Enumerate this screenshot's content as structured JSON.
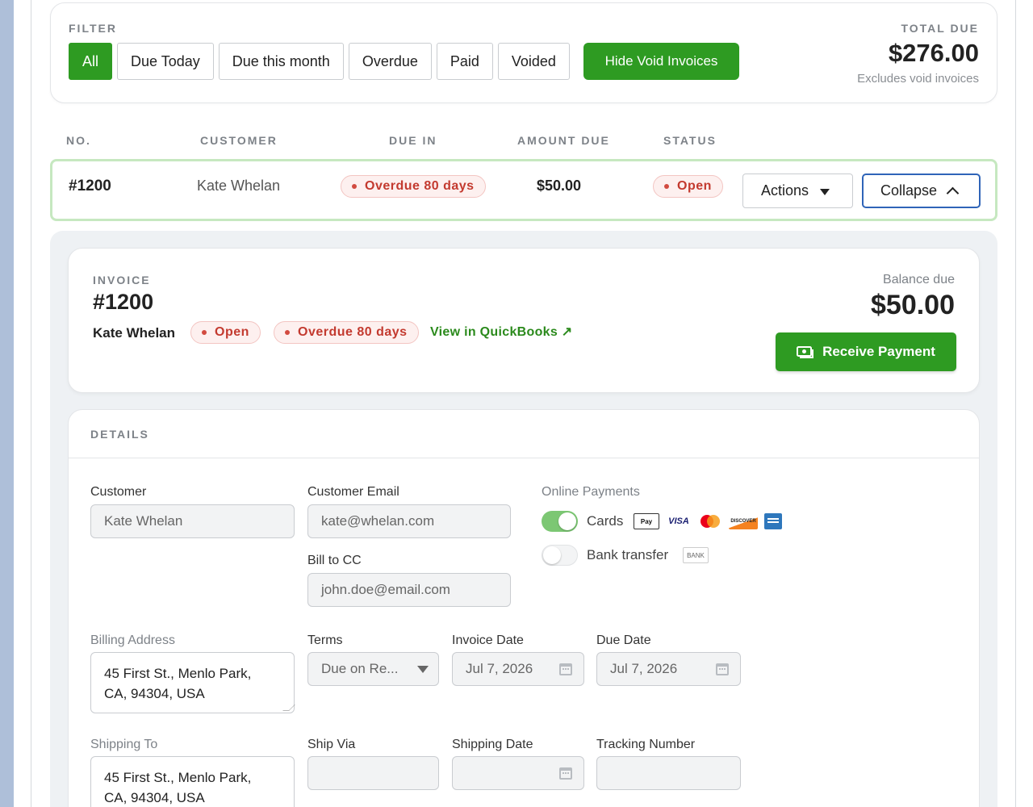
{
  "filter": {
    "label": "FILTER",
    "buttons": [
      "All",
      "Due Today",
      "Due this month",
      "Overdue",
      "Paid",
      "Voided"
    ],
    "active": "All",
    "hide_void": "Hide Void Invoices",
    "total_label": "TOTAL DUE",
    "total_value": "$276.00",
    "total_sub": "Excludes void invoices"
  },
  "table": {
    "headers": [
      "NO.",
      "CUSTOMER",
      "DUE IN",
      "AMOUNT DUE",
      "STATUS"
    ],
    "row": {
      "no": "#1200",
      "customer": "Kate Whelan",
      "due_in": "Overdue 80 days",
      "amount": "$50.00",
      "status": "Open",
      "actions": "Actions",
      "collapse": "Collapse"
    }
  },
  "invoice": {
    "label": "INVOICE",
    "number": "#1200",
    "customer": "Kate Whelan",
    "status": "Open",
    "overdue": "Overdue 80 days",
    "qb_link": "View in QuickBooks ↗",
    "balance_label": "Balance due",
    "balance_value": "$50.00",
    "receive_btn": "Receive Payment"
  },
  "details": {
    "title": "DETAILS",
    "customer_label": "Customer",
    "customer_value": "Kate Whelan",
    "email_label": "Customer Email",
    "email_value": "kate@whelan.com",
    "bcc_label": "Bill to CC",
    "bcc_value": "john.doe@email.com",
    "online_label": "Online Payments",
    "cards_label": "Cards",
    "cards_enabled": true,
    "bank_label": "Bank transfer",
    "bank_enabled": false,
    "bank_badge": "BANK",
    "card_logos": [
      "Pay",
      "VISA",
      "MasterCard",
      "DISCOVER",
      "AMEX"
    ],
    "billing_label": "Billing Address",
    "billing_line1": "45 First St., Menlo Park,",
    "billing_line2": "CA, 94304, USA",
    "terms_label": "Terms",
    "terms_value": "Due on Re...",
    "invoice_date_label": "Invoice Date",
    "invoice_date_value": "Jul 7, 2026",
    "due_date_label": "Due Date",
    "due_date_value": "Jul 7, 2026",
    "shipping_label": "Shipping To",
    "shipping_line1": "45 First St., Menlo Park,",
    "shipping_line2": "CA, 94304, USA",
    "ship_via_label": "Ship Via",
    "ship_via_value": "",
    "shipping_date_label": "Shipping Date",
    "shipping_date_value": "",
    "tracking_label": "Tracking Number",
    "tracking_value": ""
  },
  "colors": {
    "accent": "#2e9b22",
    "danger": "#c33a2f",
    "link": "#2b8a1c",
    "focus": "#2f64b8"
  }
}
